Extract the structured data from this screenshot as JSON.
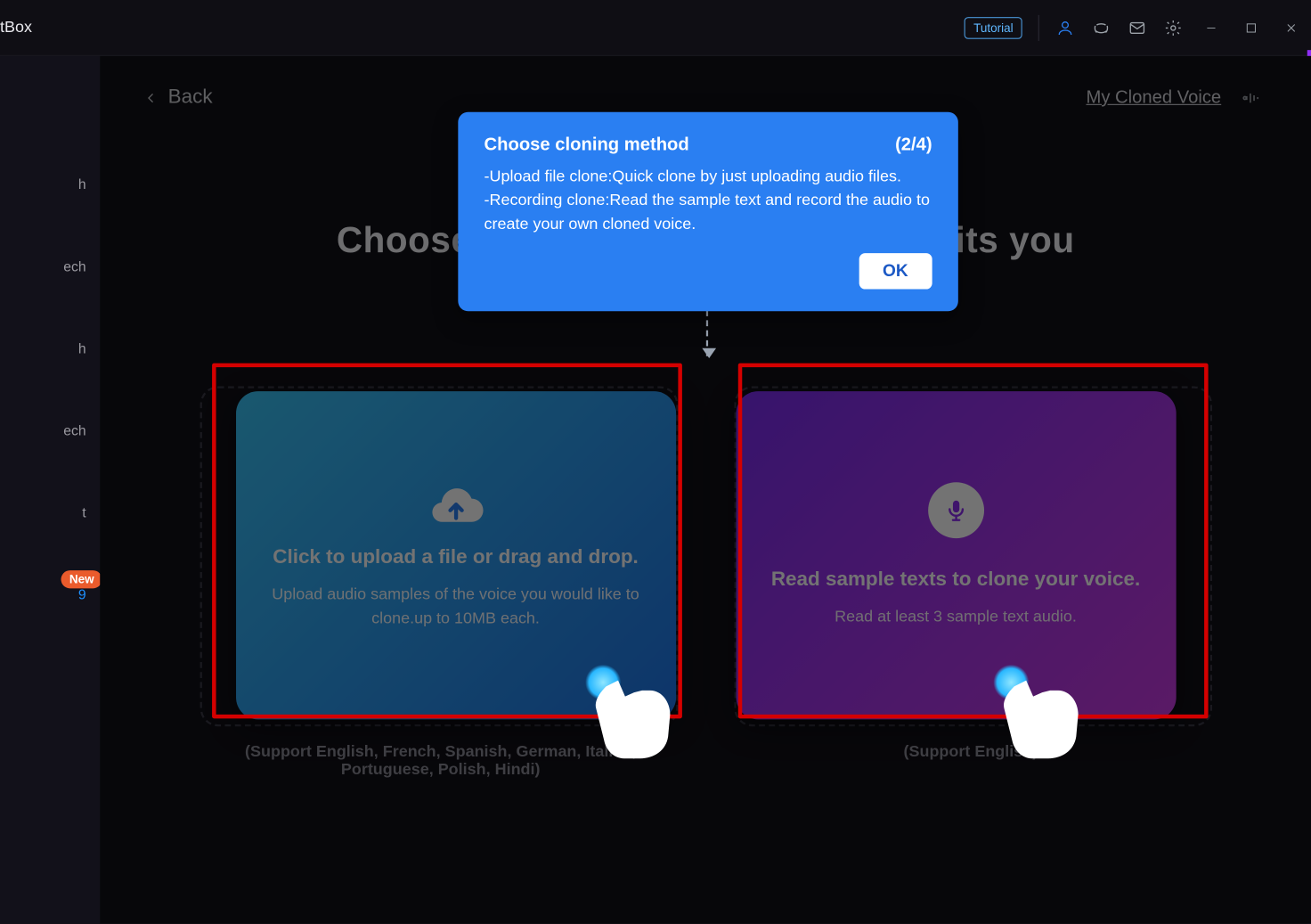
{
  "app": {
    "title_fragment": "tBox"
  },
  "titlebar": {
    "tutorial": "Tutorial"
  },
  "sidenav": {
    "items": [
      "h",
      "ech",
      "h",
      "ech",
      "t",
      "9"
    ],
    "new_label": "New"
  },
  "top": {
    "back": "Back",
    "my_cloned_voice": "My Cloned Voice"
  },
  "headline": "Choose the cloning method that suits you",
  "cards": {
    "upload": {
      "title": "Click to upload a file or drag and drop.",
      "subtitle": "Upload audio samples of the voice you would like to clone.up to 10MB each.",
      "support": "(Support English, French, Spanish, German, Italian, Portuguese, Polish, Hindi)"
    },
    "record": {
      "title": "Read sample texts to clone your voice.",
      "subtitle": "Read at least 3 sample text audio.",
      "support": "(Support English)"
    }
  },
  "tutorial": {
    "title": "Choose cloning method",
    "step": "(2/4)",
    "body_line1": "-Upload file clone:Quick clone by just uploading audio files.",
    "body_line2": "-Recording clone:Read the sample text and record the audio to create your own cloned voice.",
    "ok": "OK"
  }
}
